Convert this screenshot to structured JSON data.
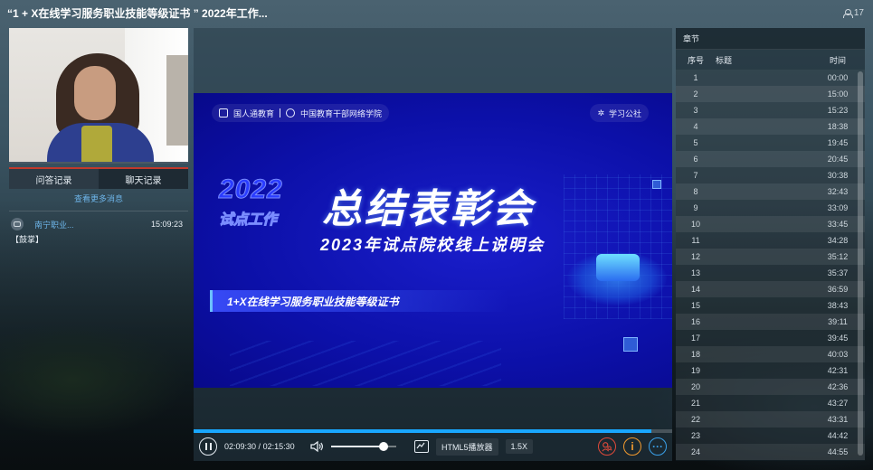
{
  "header": {
    "title": "“1 + X在线学习服务职业技能等级证书 ” 2022年工作...",
    "viewer_count": "17"
  },
  "left": {
    "tabs": [
      "问答记录",
      "聊天记录"
    ],
    "more_messages": "查看更多消息",
    "messages": [
      {
        "name": "南宁职业...",
        "time": "15:09:23",
        "text": "【鼓掌】"
      }
    ]
  },
  "slide": {
    "logo_left_1": "国人通教育",
    "logo_left_2": "中国教育干部网络学院",
    "logo_right": "学习公社",
    "year": "2022",
    "year_sub": "试点工作",
    "headline": "总结表彰会",
    "line2": "2023年试点院校线上说明会",
    "badge": "1+X在线学习服务职业技能等级证书"
  },
  "player": {
    "current_time": "02:09:30",
    "total_time": "02:15:30",
    "player_label": "HTML5播放器",
    "speed": "1.5X",
    "progress": 0.956,
    "volume": 0.8
  },
  "chapters": {
    "title": "章节",
    "headers": {
      "num": "序号",
      "title": "标题",
      "time": "时间"
    },
    "rows": [
      {
        "num": "1",
        "time": "00:00"
      },
      {
        "num": "2",
        "time": "15:00"
      },
      {
        "num": "3",
        "time": "15:23"
      },
      {
        "num": "4",
        "time": "18:38"
      },
      {
        "num": "5",
        "time": "19:45"
      },
      {
        "num": "6",
        "time": "20:45"
      },
      {
        "num": "7",
        "time": "30:38"
      },
      {
        "num": "8",
        "time": "32:43"
      },
      {
        "num": "9",
        "time": "33:09"
      },
      {
        "num": "10",
        "time": "33:45"
      },
      {
        "num": "11",
        "time": "34:28"
      },
      {
        "num": "12",
        "time": "35:12"
      },
      {
        "num": "13",
        "time": "35:37"
      },
      {
        "num": "14",
        "time": "36:59"
      },
      {
        "num": "15",
        "time": "38:43"
      },
      {
        "num": "16",
        "time": "39:11"
      },
      {
        "num": "17",
        "time": "39:45"
      },
      {
        "num": "18",
        "time": "40:03"
      },
      {
        "num": "19",
        "time": "42:31"
      },
      {
        "num": "20",
        "time": "42:36"
      },
      {
        "num": "21",
        "time": "43:27"
      },
      {
        "num": "22",
        "time": "43:31"
      },
      {
        "num": "23",
        "time": "44:42"
      },
      {
        "num": "24",
        "time": "44:55"
      }
    ]
  },
  "icons": {
    "viewers": "person-icon",
    "pause": "pause-icon",
    "volume": "speaker-icon",
    "screen": "screen-icon",
    "search_user": "user-search-icon",
    "info": "info-icon",
    "more": "more-icon"
  }
}
